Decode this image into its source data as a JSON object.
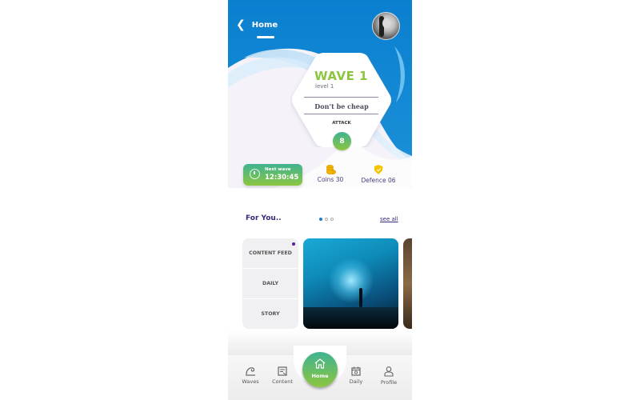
{
  "header": {
    "back_label": "Home",
    "avatar_icon": "user-avatar"
  },
  "wave_card": {
    "title": "WAVE 1",
    "level": "level 1",
    "task": "Don’t be cheap",
    "type": "ATTACK",
    "count": "8"
  },
  "stats": {
    "next_wave_label": "Next wave",
    "next_wave_time": "12:30:45",
    "coins_label": "Coins 30",
    "defence_label": "Defence 06"
  },
  "for_you": {
    "title": "For You..",
    "see_all": "see all",
    "page_count": 3,
    "active_page": 1,
    "categories": [
      {
        "label": "CONTENT FEED",
        "has_new": true
      },
      {
        "label": "DAILY",
        "has_new": false
      },
      {
        "label": "STORY",
        "has_new": false
      }
    ]
  },
  "bottom_nav": {
    "items": [
      {
        "label": "Waves",
        "icon": "waves-icon"
      },
      {
        "label": "Content",
        "icon": "content-icon"
      },
      {
        "label": "Home",
        "icon": "home-icon"
      },
      {
        "label": "Daily",
        "icon": "calendar-icon"
      },
      {
        "label": "Profile",
        "icon": "profile-icon"
      }
    ]
  },
  "colors": {
    "primary_blue": "#0a7fcf",
    "accent_green": "#8cc63f",
    "accent_teal": "#3fb391",
    "text_purple": "#3b2a7b"
  }
}
